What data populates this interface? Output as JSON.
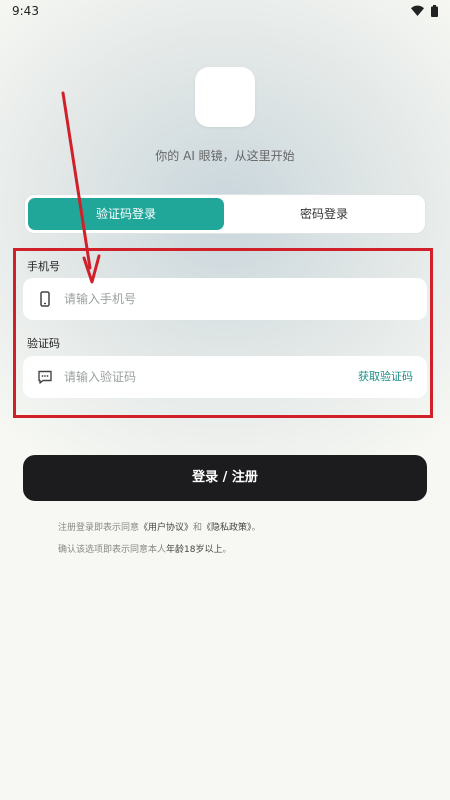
{
  "status_bar": {
    "time": "9:43",
    "wifi_icon": "wifi-icon",
    "battery_icon": "battery-icon"
  },
  "header": {
    "tagline": "你的 AI 眼镜，从这里开始"
  },
  "tabs": [
    {
      "label": "验证码登录",
      "active": true
    },
    {
      "label": "密码登录",
      "active": false
    }
  ],
  "form": {
    "phone": {
      "label": "手机号",
      "placeholder": "请输入手机号",
      "value": "",
      "icon": "phone-icon"
    },
    "code": {
      "label": "验证码",
      "placeholder": "请输入验证码",
      "value": "",
      "icon": "message-icon",
      "action_label": "获取验证码"
    }
  },
  "submit": {
    "label": "登录 / 注册"
  },
  "agreement": {
    "line1_prefix": "注册登录即表示同意",
    "user_agreement": "《用户协议》",
    "line1_and": "和",
    "privacy_policy": "《隐私政策》",
    "line1_suffix": "。",
    "line2_prefix": "确认该选项即表示同意本人",
    "line2_emph": "年龄18岁以上",
    "line2_suffix": "。"
  },
  "colors": {
    "accent": "#20a79a",
    "link": "#1c8e86",
    "primary_button": "#1c1c1e",
    "annotation": "#d0202a"
  }
}
